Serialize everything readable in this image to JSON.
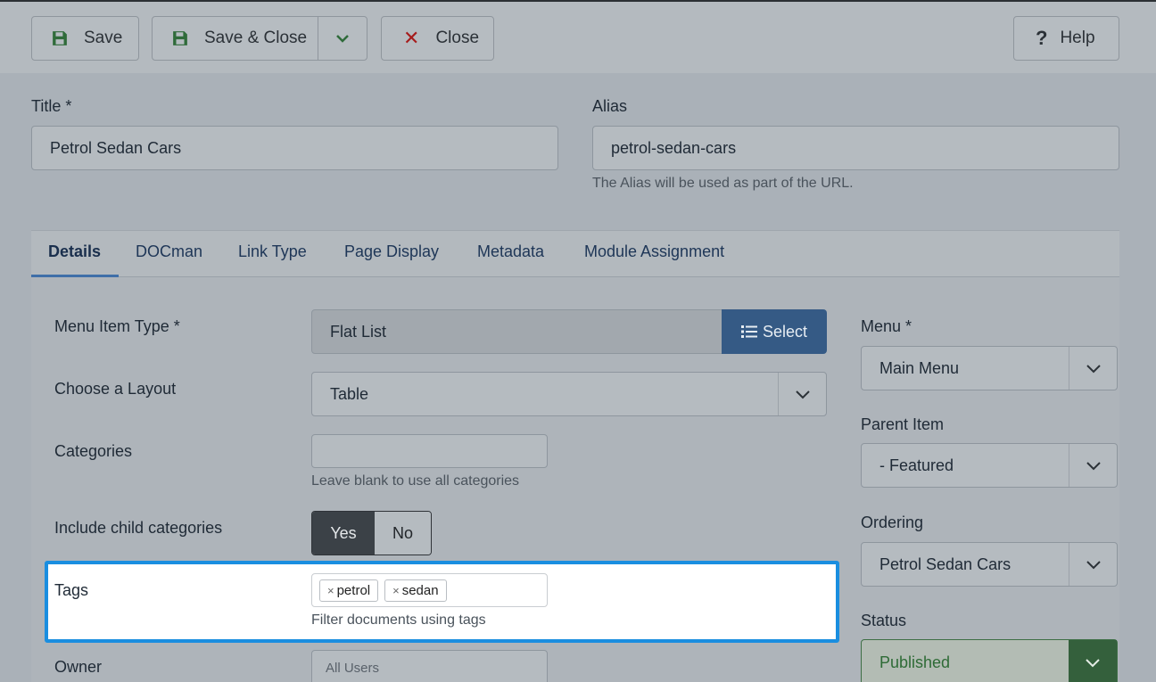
{
  "toolbar": {
    "save_label": "Save",
    "save_close_label": "Save & Close",
    "close_label": "Close",
    "help_label": "Help"
  },
  "title_field": {
    "label": "Title *",
    "value": "Petrol Sedan Cars"
  },
  "alias_field": {
    "label": "Alias",
    "value": "petrol-sedan-cars",
    "hint": "The Alias will be used as part of the URL."
  },
  "tabs": [
    {
      "label": "Details"
    },
    {
      "label": "DOCman"
    },
    {
      "label": "Link Type"
    },
    {
      "label": "Page Display"
    },
    {
      "label": "Metadata"
    },
    {
      "label": "Module Assignment"
    }
  ],
  "details": {
    "menu_item_type": {
      "label": "Menu Item Type *",
      "value": "Flat List",
      "button": "Select"
    },
    "layout": {
      "label": "Choose a Layout",
      "value": "Table"
    },
    "categories": {
      "label": "Categories",
      "value": "",
      "hint": "Leave blank to use all categories"
    },
    "include_child": {
      "label": "Include child categories",
      "yes": "Yes",
      "no": "No",
      "selected": "Yes"
    },
    "tags": {
      "label": "Tags",
      "items": [
        "petrol",
        "sedan"
      ],
      "hint": "Filter documents using tags"
    },
    "owner": {
      "label": "Owner",
      "placeholder": "All Users"
    }
  },
  "sidebar": {
    "menu": {
      "label": "Menu *",
      "value": "Main Menu"
    },
    "parent": {
      "label": "Parent Item",
      "value": "- Featured"
    },
    "ordering": {
      "label": "Ordering",
      "value": "Petrol Sedan Cars"
    },
    "status": {
      "label": "Status",
      "value": "Published"
    }
  },
  "colors": {
    "primary": "#355a85",
    "highlight": "#1a8ee0",
    "published": "#34603c",
    "danger": "#a61c1c"
  }
}
